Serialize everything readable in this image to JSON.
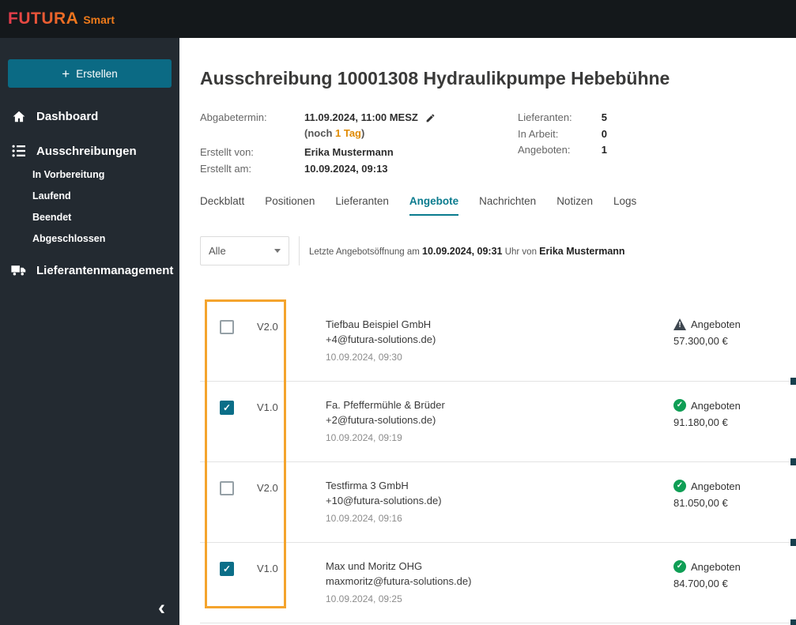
{
  "topbar": {
    "brand": "FUTURA",
    "brand_suffix": "Smart"
  },
  "icons": {
    "plus": "+",
    "collapse": "‹"
  },
  "sidebar": {
    "create_label": "Erstellen",
    "items": [
      {
        "label": "Dashboard"
      },
      {
        "label": "Ausschreibungen"
      },
      {
        "label": "Lieferantenmanagement"
      }
    ],
    "sub_items": [
      "In Vorbereitung",
      "Laufend",
      "Beendet",
      "Abgeschlossen"
    ]
  },
  "header": {
    "title": "Ausschreibung 10001308 Hydraulikpumpe Hebebühne",
    "deadline_label": "Abgabetermin:",
    "deadline_value": "11.09.2024, 11:00 MESZ",
    "deadline_remaining_prefix": "(noch ",
    "deadline_remaining": "1 Tag",
    "deadline_remaining_suffix": ")",
    "created_by_label": "Erstellt von:",
    "created_by": "Erika Mustermann",
    "created_at_label": "Erstellt am:",
    "created_at": "10.09.2024, 09:13",
    "stats": [
      {
        "label": "Lieferanten:",
        "value": "5"
      },
      {
        "label": "In Arbeit:",
        "value": "0"
      },
      {
        "label": "Angeboten:",
        "value": "1"
      }
    ]
  },
  "tabs": [
    {
      "label": "Deckblatt",
      "active": false
    },
    {
      "label": "Positionen",
      "active": false
    },
    {
      "label": "Lieferanten",
      "active": false
    },
    {
      "label": "Angebote",
      "active": true
    },
    {
      "label": "Nachrichten",
      "active": false
    },
    {
      "label": "Notizen",
      "active": false
    },
    {
      "label": "Logs",
      "active": false
    }
  ],
  "filter": {
    "dropdown_value": "Alle",
    "info_prefix": "Letzte Angebotsöffnung am ",
    "info_date": "10.09.2024, 09:31",
    "info_middle": " Uhr von ",
    "info_name": "Erika Mustermann"
  },
  "offers": [
    {
      "version": "V2.0",
      "checked": false,
      "company": "Tiefbau Beispiel GmbH",
      "email": "+4@futura-solutions.de)",
      "date": "10.09.2024, 09:30",
      "status": "Angeboten",
      "status_icon": "warning",
      "amount": "57.300,00 €"
    },
    {
      "version": "V1.0",
      "checked": true,
      "company": "Fa. Pfeffermühle & Brüder",
      "email": "+2@futura-solutions.de)",
      "date": "10.09.2024, 09:19",
      "status": "Angeboten",
      "status_icon": "success",
      "amount": "91.180,00 €"
    },
    {
      "version": "V2.0",
      "checked": false,
      "company": "Testfirma 3 GmbH",
      "email": "+10@futura-solutions.de)",
      "date": "10.09.2024, 09:16",
      "status": "Angeboten",
      "status_icon": "success",
      "amount": "81.050,00 €"
    },
    {
      "version": "V1.0",
      "checked": true,
      "company": "Max und Moritz OHG",
      "email": "maxmoritz@futura-solutions.de)",
      "date": "10.09.2024, 09:25",
      "status": "Angeboten",
      "status_icon": "success",
      "amount": "84.700,00 €"
    }
  ],
  "colors": {
    "accent_teal": "#0b6e88",
    "active_tab_teal": "#0a7b8e",
    "success_green": "#0f9e55",
    "warning_dark": "#3e4750",
    "annotation_orange": "#f4a42d",
    "brand_red": "#e43a4e",
    "brand_orange": "#ee7a1a",
    "deadline_orange": "#e08a00"
  }
}
